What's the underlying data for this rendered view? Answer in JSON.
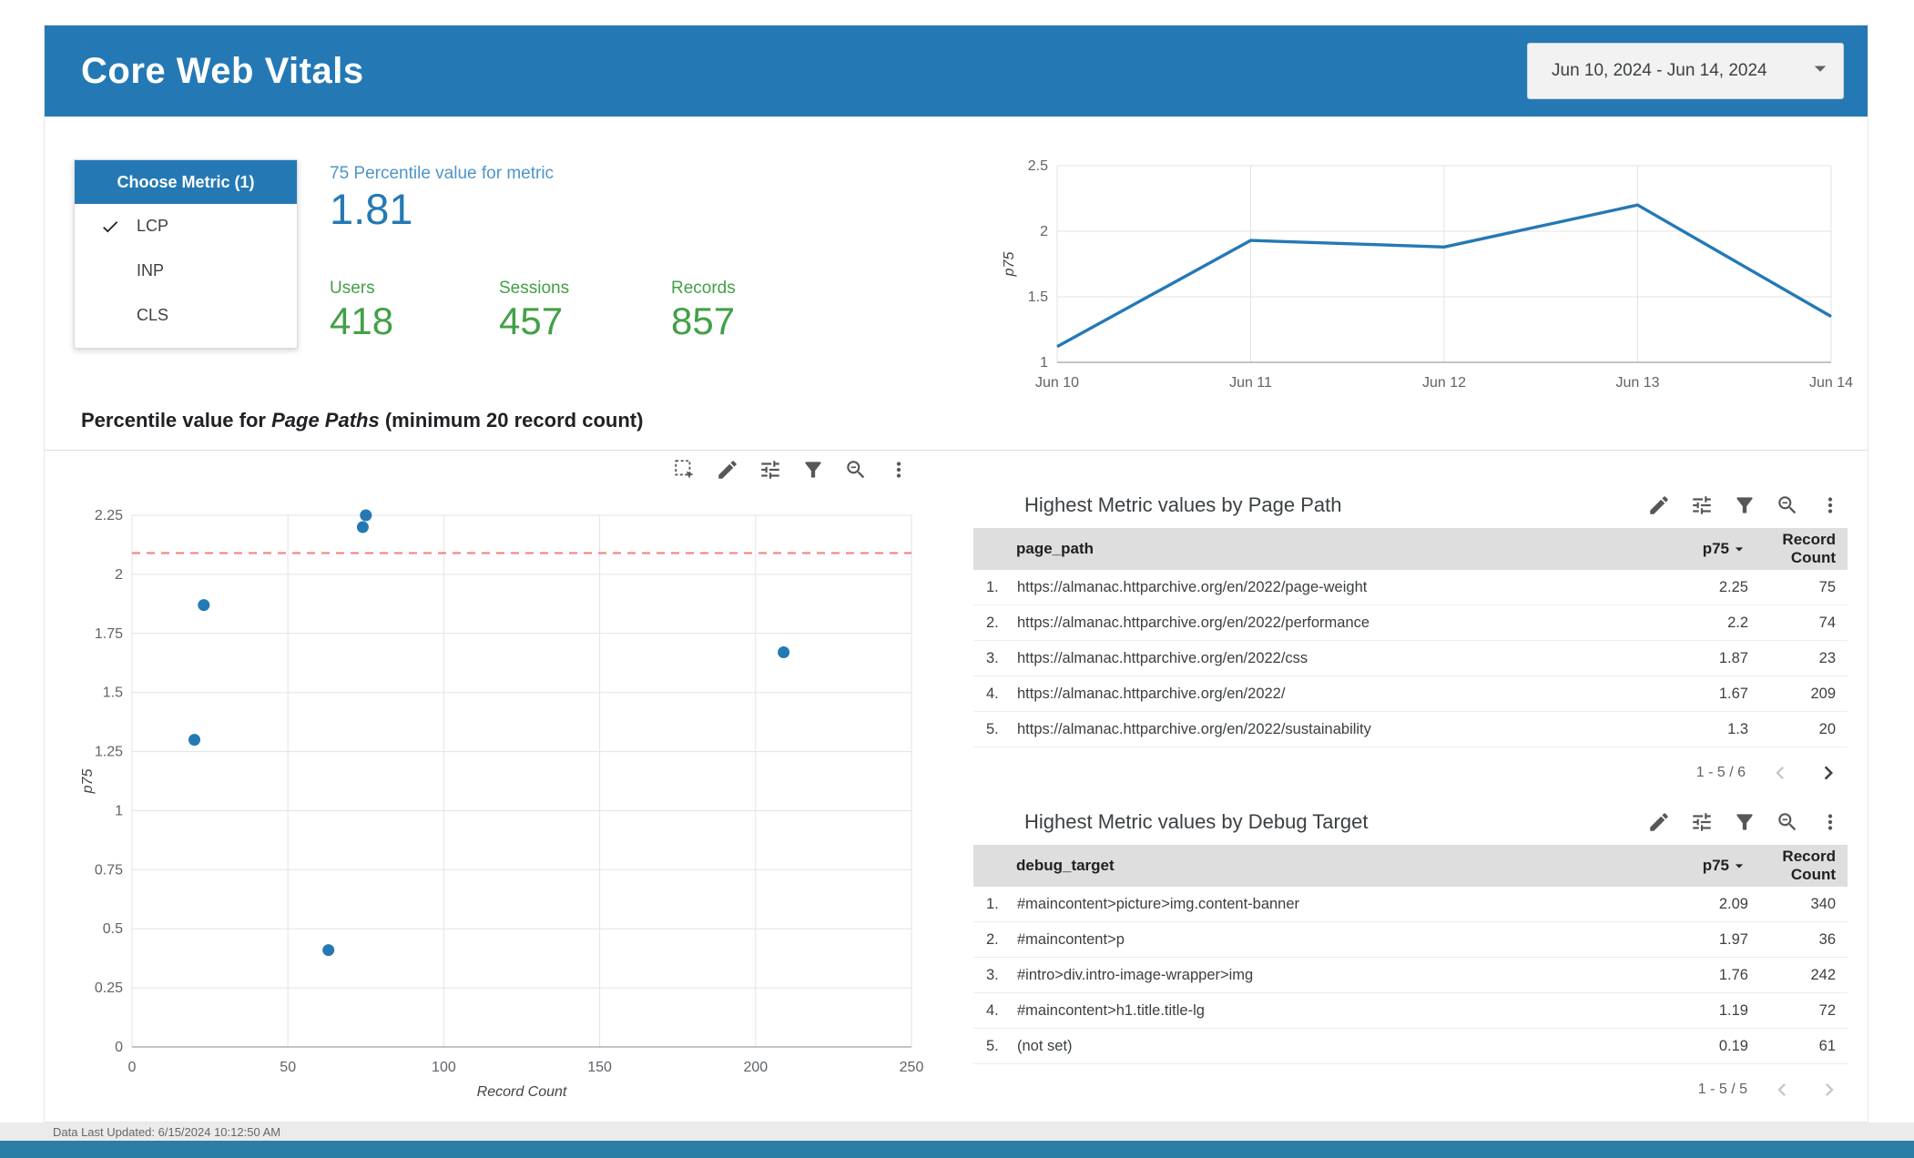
{
  "colors": {
    "header_blue": "#2479b5",
    "accent_blue_light": "#4e95c7",
    "green": "#43a047",
    "reference_red": "#ef7f76",
    "table_header_bg": "#dedede",
    "footer_strip": "#2b7ea6"
  },
  "header": {
    "title": "Core Web Vitals",
    "date_range": "Jun 10, 2024 - Jun 14, 2024"
  },
  "metric_selector": {
    "title": "Choose Metric (1)",
    "options": [
      {
        "label": "LCP",
        "selected": true
      },
      {
        "label": "INP",
        "selected": false
      },
      {
        "label": "CLS",
        "selected": false
      }
    ]
  },
  "scorecards": {
    "percentile_label": "75 Percentile value for metric",
    "percentile_value": "1.81",
    "users_label": "Users",
    "users_value": "418",
    "sessions_label": "Sessions",
    "sessions_value": "457",
    "records_label": "Records",
    "records_value": "857"
  },
  "section": {
    "title_prefix": "Percentile value for ",
    "title_italic": "Page Paths",
    "title_suffix": " (minimum 20 record count)"
  },
  "chart_data": [
    {
      "type": "line",
      "x": [
        "Jun 10",
        "Jun 11",
        "Jun 12",
        "Jun 13",
        "Jun 14"
      ],
      "series": [
        {
          "name": "p75",
          "values": [
            1.12,
            1.93,
            1.88,
            2.2,
            1.35
          ]
        }
      ],
      "ylabel": "p75",
      "ylim": [
        1,
        2.5
      ],
      "yticks": [
        1,
        1.5,
        2,
        2.5
      ],
      "grid": true,
      "line_color": "#2479b5"
    },
    {
      "type": "scatter",
      "title": "Percentile value for Page Paths (minimum 20 record count)",
      "xlabel": "Record Count",
      "ylabel": "p75",
      "xlim": [
        0,
        250
      ],
      "ylim": [
        0,
        2.25
      ],
      "xticks": [
        0,
        50,
        100,
        150,
        200,
        250
      ],
      "yticks": [
        0,
        0.25,
        0.5,
        0.75,
        1,
        1.25,
        1.5,
        1.75,
        2,
        2.25
      ],
      "points": [
        {
          "x": 75,
          "y": 2.25
        },
        {
          "x": 74,
          "y": 2.2
        },
        {
          "x": 23,
          "y": 1.87
        },
        {
          "x": 209,
          "y": 1.67
        },
        {
          "x": 20,
          "y": 1.3
        },
        {
          "x": 63,
          "y": 0.41
        }
      ],
      "reference_line_y": 2.09,
      "reference_color": "#ef7f76",
      "point_color": "#2479b5",
      "grid": true
    }
  ],
  "tables": {
    "page_path": {
      "title": "Highest Metric values by Page Path",
      "columns": {
        "dim": "page_path",
        "metric": "p75",
        "count": "Record Count"
      },
      "rows": [
        {
          "n": "1.",
          "dim": "https://almanac.httparchive.org/en/2022/page-weight",
          "p75": "2.25",
          "count": "75"
        },
        {
          "n": "2.",
          "dim": "https://almanac.httparchive.org/en/2022/performance",
          "p75": "2.2",
          "count": "74"
        },
        {
          "n": "3.",
          "dim": "https://almanac.httparchive.org/en/2022/css",
          "p75": "1.87",
          "count": "23"
        },
        {
          "n": "4.",
          "dim": "https://almanac.httparchive.org/en/2022/",
          "p75": "1.67",
          "count": "209"
        },
        {
          "n": "5.",
          "dim": "https://almanac.httparchive.org/en/2022/sustainability",
          "p75": "1.3",
          "count": "20"
        }
      ],
      "pagination": "1 - 5 / 6"
    },
    "debug_target": {
      "title": "Highest Metric values by Debug Target",
      "columns": {
        "dim": "debug_target",
        "metric": "p75",
        "count": "Record Count"
      },
      "rows": [
        {
          "n": "1.",
          "dim": "#maincontent>picture>img.content-banner",
          "p75": "2.09",
          "count": "340"
        },
        {
          "n": "2.",
          "dim": "#maincontent>p",
          "p75": "1.97",
          "count": "36"
        },
        {
          "n": "3.",
          "dim": "#intro>div.intro-image-wrapper>img",
          "p75": "1.76",
          "count": "242"
        },
        {
          "n": "4.",
          "dim": "#maincontent>h1.title.title-lg",
          "p75": "1.19",
          "count": "72"
        },
        {
          "n": "5.",
          "dim": "(not set)",
          "p75": "0.19",
          "count": "61"
        }
      ],
      "pagination": "1 - 5 / 5"
    }
  },
  "footer": {
    "last_updated": "Data Last Updated: 6/15/2024 10:12:50 AM"
  }
}
